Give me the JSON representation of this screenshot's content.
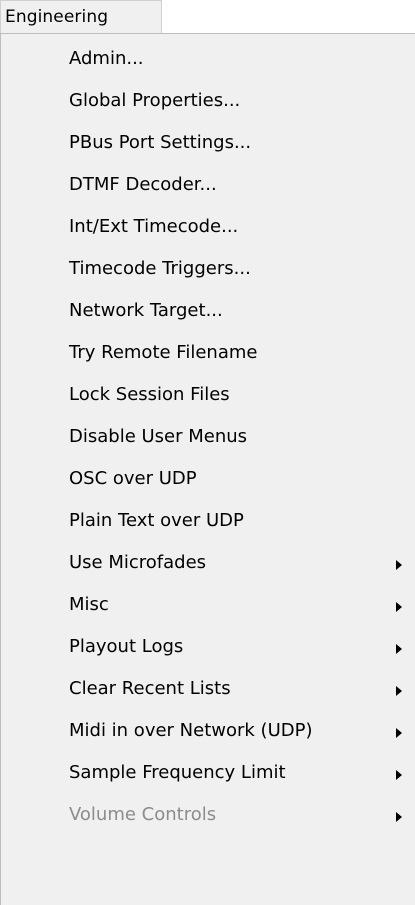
{
  "menubar": {
    "title": "Engineering"
  },
  "menu": {
    "items": [
      {
        "label": "Admin...",
        "has_submenu": false,
        "enabled": true
      },
      {
        "label": "Global Properties...",
        "has_submenu": false,
        "enabled": true
      },
      {
        "label": "PBus Port Settings...",
        "has_submenu": false,
        "enabled": true
      },
      {
        "label": "DTMF Decoder...",
        "has_submenu": false,
        "enabled": true
      },
      {
        "label": "Int/Ext Timecode...",
        "has_submenu": false,
        "enabled": true
      },
      {
        "label": "Timecode Triggers...",
        "has_submenu": false,
        "enabled": true
      },
      {
        "label": "Network Target...",
        "has_submenu": false,
        "enabled": true
      },
      {
        "label": "Try Remote Filename",
        "has_submenu": false,
        "enabled": true
      },
      {
        "label": "Lock Session Files",
        "has_submenu": false,
        "enabled": true
      },
      {
        "label": "Disable User Menus",
        "has_submenu": false,
        "enabled": true
      },
      {
        "label": "OSC over UDP",
        "has_submenu": false,
        "enabled": true
      },
      {
        "label": "Plain Text over UDP",
        "has_submenu": false,
        "enabled": true
      },
      {
        "label": "Use Microfades",
        "has_submenu": true,
        "enabled": true
      },
      {
        "label": "Misc",
        "has_submenu": true,
        "enabled": true
      },
      {
        "label": "Playout Logs",
        "has_submenu": true,
        "enabled": true
      },
      {
        "label": "Clear Recent Lists",
        "has_submenu": true,
        "enabled": true
      },
      {
        "label": "Midi in over Network (UDP)",
        "has_submenu": true,
        "enabled": true
      },
      {
        "label": "Sample Frequency Limit",
        "has_submenu": true,
        "enabled": true
      },
      {
        "label": "Volume Controls",
        "has_submenu": true,
        "enabled": false
      }
    ]
  },
  "colors": {
    "menu_background": "#f0f0f0",
    "text": "#000000",
    "disabled_text": "#8c8c8c"
  }
}
